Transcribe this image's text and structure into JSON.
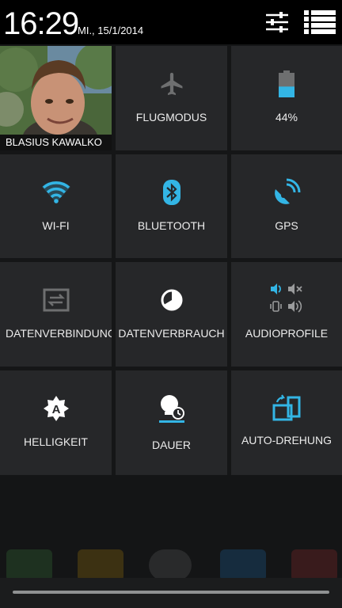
{
  "status": {
    "time": "16:29",
    "date": "MI., 15/1/2014"
  },
  "header_buttons": {
    "settings_icon": "sliders-icon",
    "notifications_icon": "list-icon"
  },
  "profile": {
    "name": "BLASIUS KAWALKO"
  },
  "tiles": {
    "flugmodus": "FLUGMODUS",
    "battery": "44%",
    "battery_level": 0.44,
    "wifi": "WI-FI",
    "bluetooth": "BLUETOOTH",
    "gps": "GPS",
    "datenverbindung": "DATENVERBINDUNG",
    "datenverbrauch": "DATENVERBRAUCH",
    "audioprofile": "AUDIOPROFILE",
    "helligkeit": "HELLIGKEIT",
    "dauer": "DAUER",
    "autodrehung": "AUTO-DREHUNG"
  },
  "colors": {
    "accent": "#33b5e5",
    "tile_bg": "#262729",
    "background": "#151617"
  }
}
